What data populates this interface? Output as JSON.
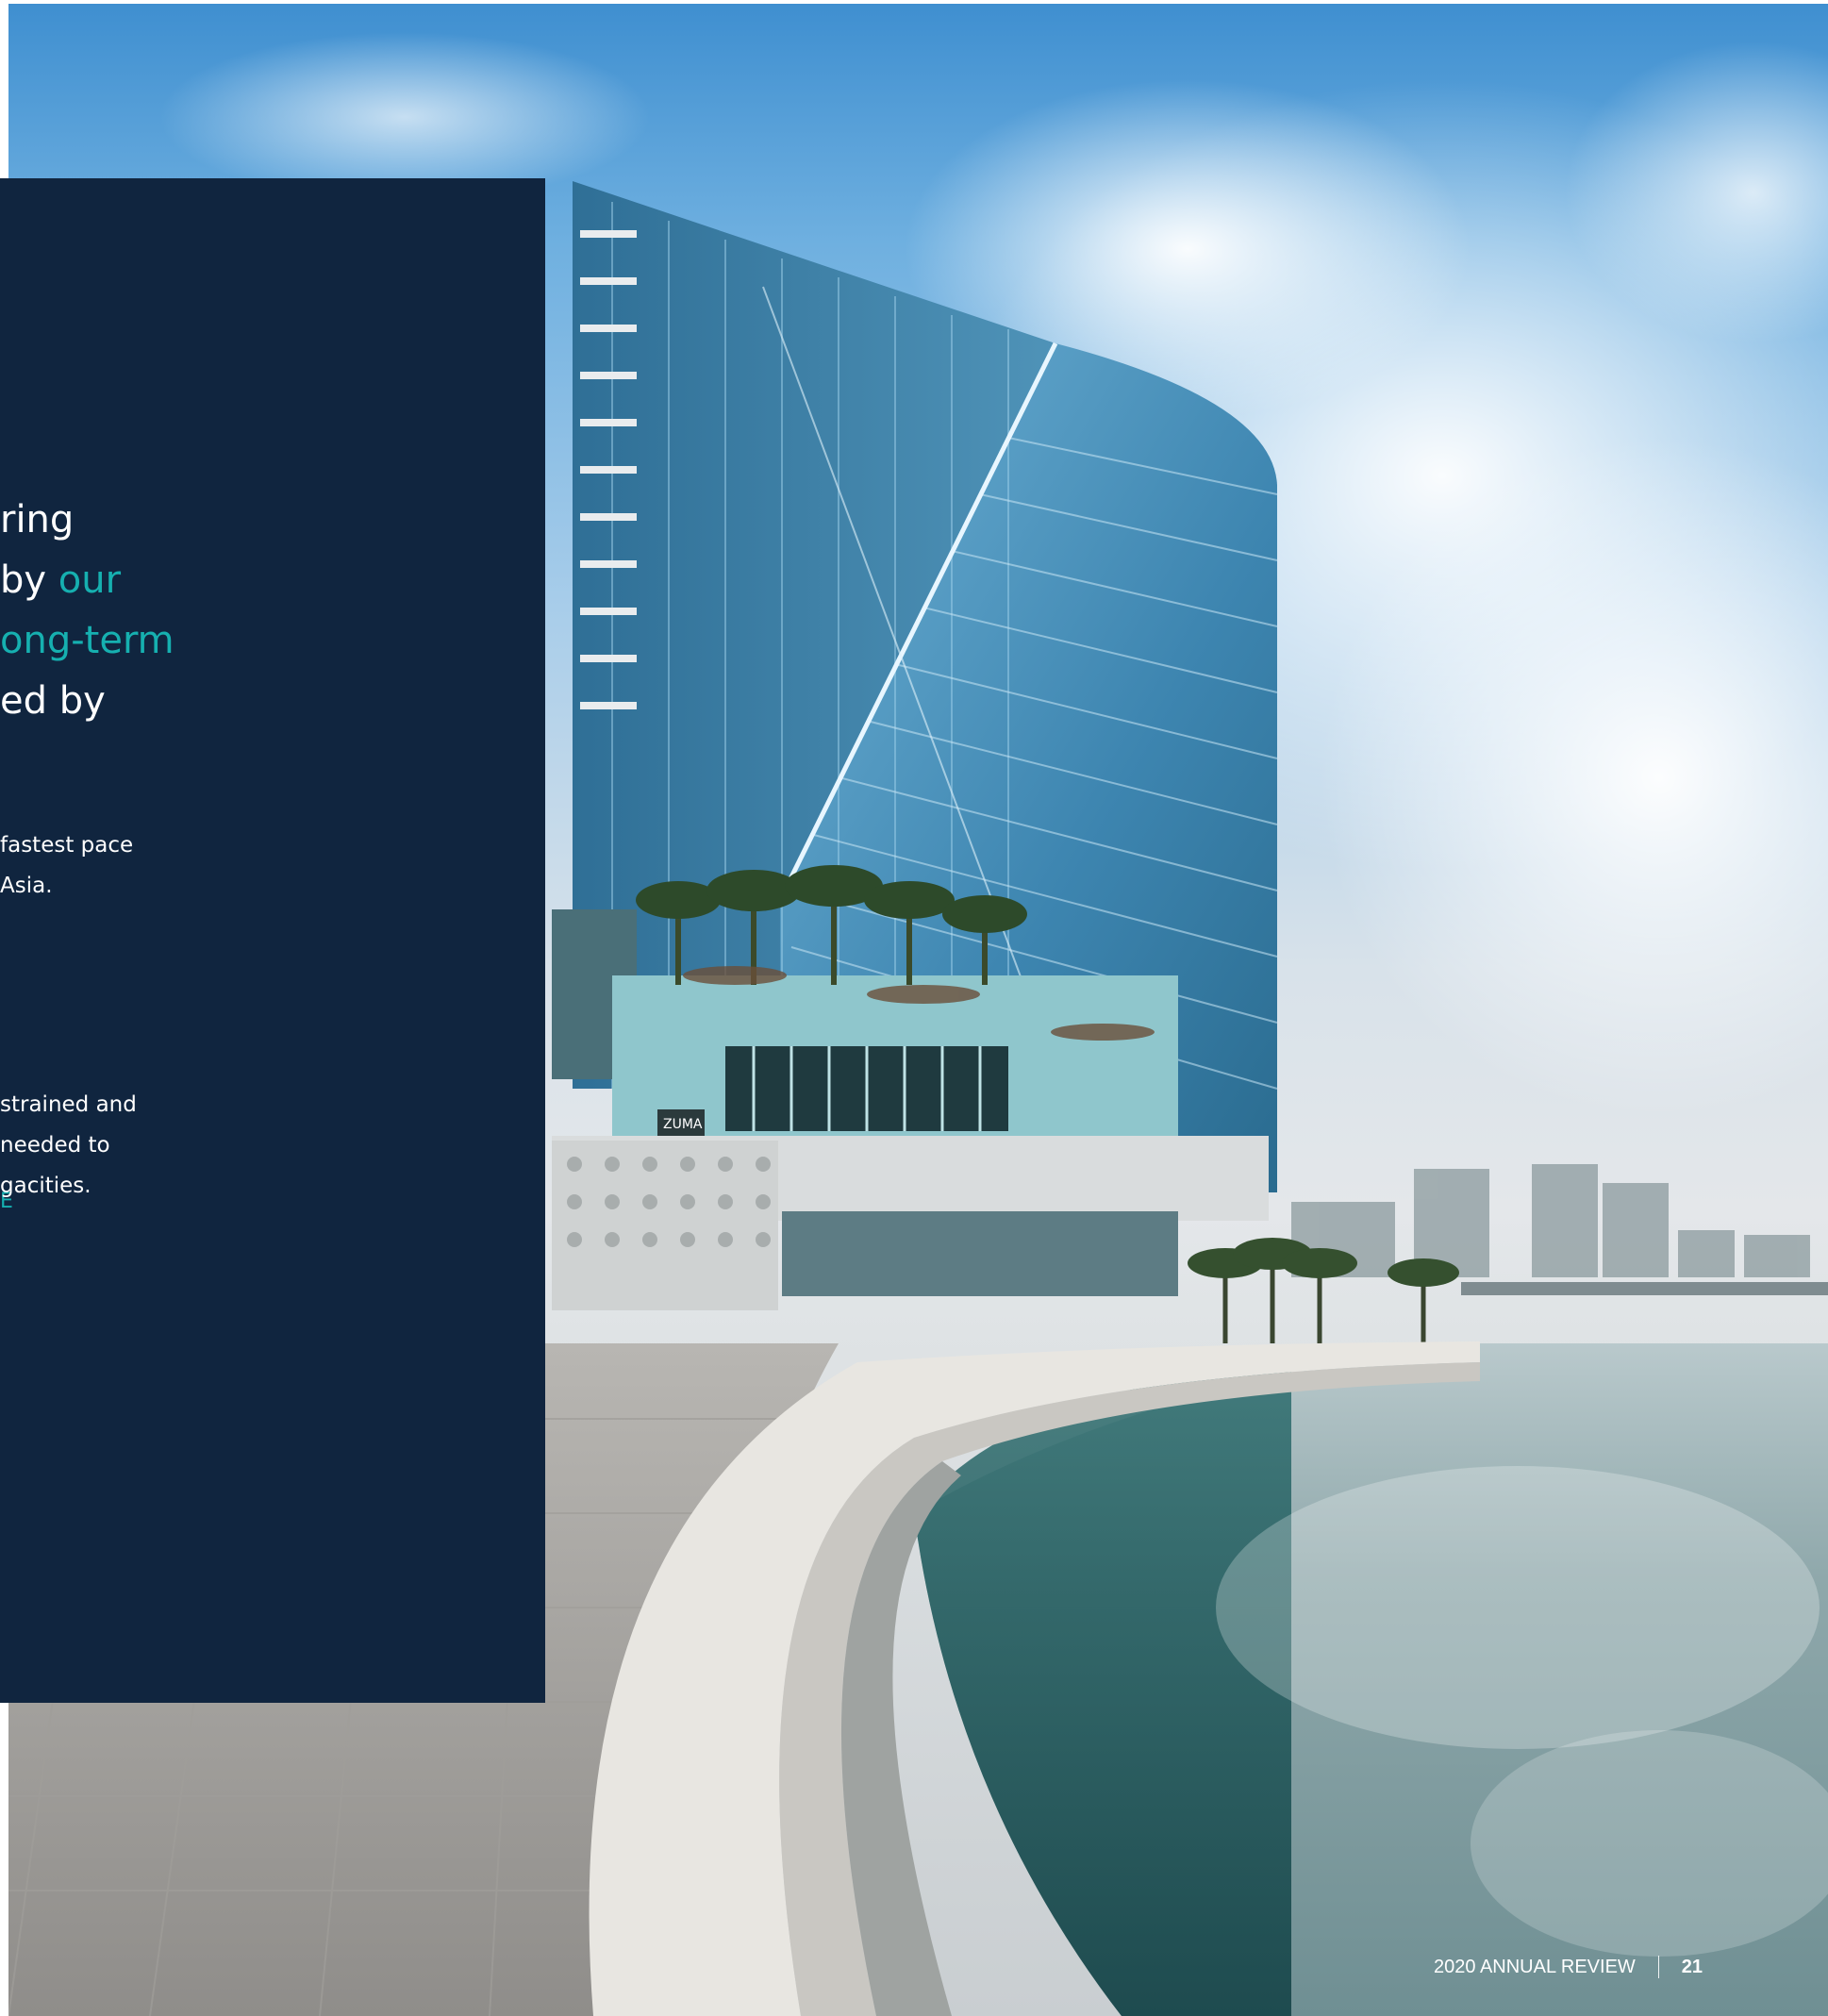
{
  "headline": {
    "line1_white": "ring",
    "line2_white": "by ",
    "line2_teal": "our",
    "line3_teal": "ong-term",
    "line4_white": "ed by"
  },
  "paragraph1": {
    "line1": " fastest pace",
    "line2": "Asia."
  },
  "section_label": "E",
  "paragraph2": {
    "line1": "strained and",
    "line2": "needed to",
    "line3": "gacities."
  },
  "photo": {
    "building_sign": "ZUMA"
  },
  "footer": {
    "publication": "2020 ANNUAL REVIEW",
    "page_number": "21"
  },
  "colors": {
    "panel": "#10253f",
    "accent_teal": "#16b0b0",
    "text": "#ffffff"
  }
}
